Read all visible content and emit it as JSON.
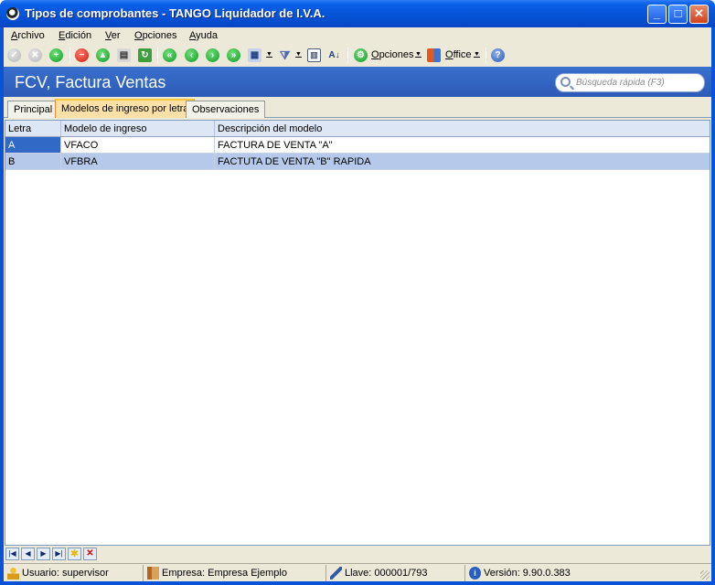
{
  "window": {
    "title": "Tipos de comprobantes - TANGO Liquidador de I.V.A."
  },
  "menu": [
    "Archivo",
    "Edición",
    "Ver",
    "Opciones",
    "Ayuda"
  ],
  "toolbar": {
    "options_label": "Opciones",
    "office_label": "Office"
  },
  "banner": {
    "title": "FCV, Factura Ventas",
    "search_placeholder": "Búsqueda rápida (F3)"
  },
  "tabs": [
    "Principal",
    "Modelos de ingreso por letra",
    "Observaciones"
  ],
  "active_tab": "Modelos de ingreso por letra",
  "grid": {
    "columns": [
      "Letra",
      "Modelo de ingreso",
      "Descripción del modelo"
    ],
    "rows": [
      [
        "A",
        "VFACO",
        "FACTURA DE  VENTA \"A\""
      ],
      [
        "B",
        "VFBRA",
        "FACTUTA  DE VENTA \"B\" RAPIDA"
      ]
    ]
  },
  "status": {
    "user": "Usuario: supervisor",
    "company": "Empresa: Empresa Ejemplo",
    "key": "Llave: 000001/793",
    "version": "Versión: 9.90.0.383"
  }
}
